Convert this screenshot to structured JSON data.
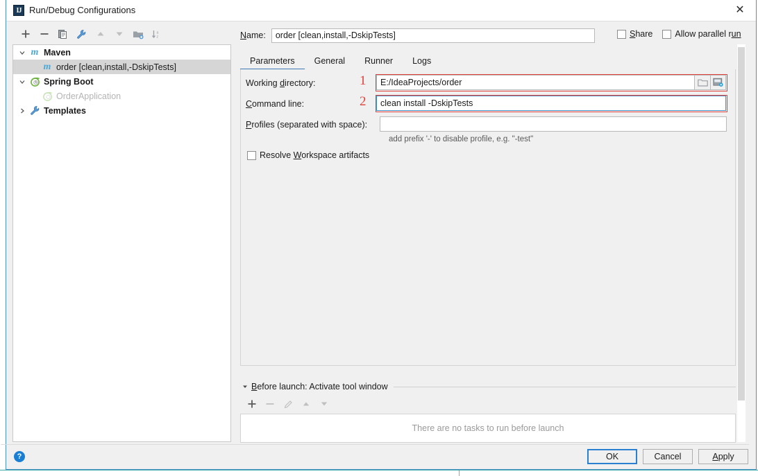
{
  "window": {
    "title": "Run/Debug Configurations",
    "app_icon": "intellij-idea-icon",
    "close_label": "✕"
  },
  "left_toolbar": {
    "buttons": [
      {
        "name": "add-configuration-button",
        "icon": "plus-icon",
        "label": "+"
      },
      {
        "name": "remove-configuration-button",
        "icon": "minus-icon",
        "label": "−"
      },
      {
        "name": "copy-configuration-button",
        "icon": "copy-icon",
        "label": "Copy"
      },
      {
        "name": "edit-templates-button",
        "icon": "wrench-icon",
        "label": "Edit Templates"
      },
      {
        "name": "move-up-button",
        "icon": "arrow-up-icon",
        "label": "Move Up"
      },
      {
        "name": "move-down-button",
        "icon": "arrow-down-icon",
        "label": "Move Down"
      },
      {
        "name": "move-into-folder-button",
        "icon": "folder-add-icon",
        "label": "Move into new folder"
      },
      {
        "name": "sort-configurations-button",
        "icon": "sort-az-icon",
        "label": "Sort configurations"
      }
    ]
  },
  "tree": {
    "nodes": [
      {
        "label": "Maven",
        "icon": "maven-m-icon",
        "expanded": true,
        "bold": true,
        "has_arrow": true,
        "dim": false,
        "selected": false,
        "indent": 0
      },
      {
        "label": "order [clean,install,-DskipTests]",
        "icon": "maven-m-icon",
        "expanded": false,
        "bold": false,
        "has_arrow": false,
        "dim": false,
        "selected": true,
        "indent": 1
      },
      {
        "label": "Spring Boot",
        "icon": "spring-boot-icon",
        "expanded": true,
        "bold": true,
        "has_arrow": true,
        "dim": false,
        "selected": false,
        "indent": 0
      },
      {
        "label": "OrderApplication",
        "icon": "spring-boot-icon",
        "expanded": false,
        "bold": false,
        "has_arrow": false,
        "dim": true,
        "selected": false,
        "indent": 1
      },
      {
        "label": "Templates",
        "icon": "wrench-icon",
        "expanded": false,
        "bold": true,
        "has_arrow": true,
        "dim": false,
        "selected": false,
        "indent": 0
      }
    ]
  },
  "name_field": {
    "label_prefix": "N",
    "label_rest": "ame:",
    "value": "order [clean,install,-DskipTests]",
    "placeholder": ""
  },
  "top_checkboxes": [
    {
      "name": "share-checkbox",
      "label_prefix": "S",
      "label_rest": "hare",
      "checked": false
    },
    {
      "name": "allow-parallel-run-checkbox",
      "label_prefix": "Allow parallel r",
      "label_rest": "un",
      "checked": false
    }
  ],
  "tabs": [
    {
      "label": "Parameters",
      "active": true
    },
    {
      "label": "General",
      "active": false
    },
    {
      "label": "Runner",
      "active": false
    },
    {
      "label": "Logs",
      "active": false
    }
  ],
  "parameters": {
    "working_directory": {
      "label_a": "Working ",
      "label_b": "d",
      "label_c": "irectory:",
      "value": "E:/IdeaProjects/order",
      "annotation": "1",
      "browse_icon": "folder-open-icon",
      "macro_icon": "insert-macro-icon"
    },
    "command_line": {
      "label_a": "C",
      "label_b": "ommand line:",
      "value": "clean install -DskipTests",
      "annotation": "2"
    },
    "profiles": {
      "label_a": "P",
      "label_b": "rofiles (separated with space):",
      "value": "",
      "hint": "add prefix '-' to disable profile, e.g. \"-test\""
    },
    "resolve_workspace_artifacts": {
      "label_a": "Resolve ",
      "label_b": "W",
      "label_c": "orkspace artifacts",
      "checked": false
    }
  },
  "before_launch": {
    "title_prefix": "B",
    "title_rest": "efore launch: Activate tool window",
    "expanded": true,
    "toolbar": [
      {
        "name": "add-task-button",
        "icon": "plus-icon",
        "label": "+",
        "enabled": true
      },
      {
        "name": "remove-task-button",
        "icon": "minus-icon",
        "label": "−",
        "enabled": false
      },
      {
        "name": "edit-task-button",
        "icon": "pencil-icon",
        "label": "Edit",
        "enabled": false
      },
      {
        "name": "task-move-up-button",
        "icon": "arrow-up-icon",
        "label": "Up",
        "enabled": false
      },
      {
        "name": "task-move-down-button",
        "icon": "arrow-down-icon",
        "label": "Down",
        "enabled": false
      }
    ],
    "empty_text": "There are no tasks to run before launch"
  },
  "footer": {
    "help_icon": "help-question-icon",
    "help_label": "?",
    "buttons": [
      {
        "name": "ok-button",
        "label": "OK",
        "primary": true
      },
      {
        "name": "cancel-button",
        "label": "Cancel",
        "primary": false
      },
      {
        "name": "apply-button",
        "label": "Apply",
        "primary": false
      }
    ]
  },
  "colors": {
    "accent": "#3c78b4",
    "annotation_red": "#e2403a",
    "window_border": "#4a90c4",
    "selection": "#d6d6d6",
    "maven_blue": "#4aa8d8",
    "spring_green": "#6db33f"
  }
}
